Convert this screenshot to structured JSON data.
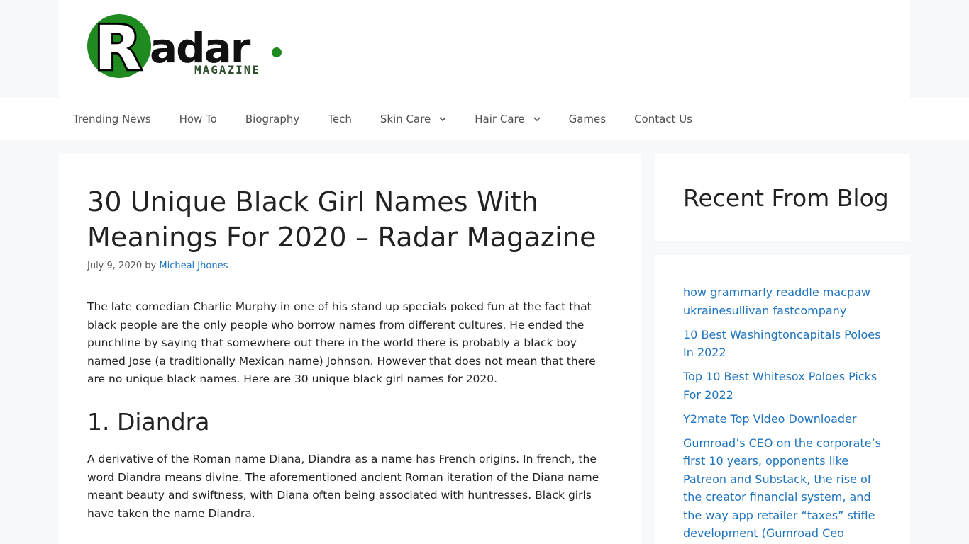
{
  "brand": {
    "logo_main": "Radar.",
    "logo_sub": "MAGAZINE",
    "green": "#1f8a1f",
    "dark_green": "#2f4f2f"
  },
  "nav": {
    "items": [
      {
        "label": "Trending News",
        "has_dropdown": false
      },
      {
        "label": "How To",
        "has_dropdown": false
      },
      {
        "label": "Biography",
        "has_dropdown": false
      },
      {
        "label": "Tech",
        "has_dropdown": false
      },
      {
        "label": "Skin Care",
        "has_dropdown": true
      },
      {
        "label": "Hair Care",
        "has_dropdown": true
      },
      {
        "label": "Games",
        "has_dropdown": false
      },
      {
        "label": "Contact Us",
        "has_dropdown": false
      }
    ]
  },
  "article": {
    "title": "30 Unique Black Girl Names With Meanings For 2020 – Radar Magazine",
    "date": "July 9, 2020",
    "by": "by",
    "author": "Micheal Jhones",
    "intro": "The late comedian Charlie Murphy in one of his stand up specials poked fun at the fact that black people are the only people who borrow names from different cultures. He ended the punchline by saying that somewhere out there in the world there is probably a black boy named Jose (a traditionally Mexican name) Johnson. However that does not mean that there are no unique black names. Here are 30 unique black girl names for 2020.",
    "section1_heading": "1. Diandra",
    "section1_text": "A derivative of the Roman name Diana, Diandra as a name has French origins. In french, the word Diandra means divine. The aforementioned ancient Roman iteration of the Diana name meant beauty and swiftness, with Diana often being associated with huntresses. Black girls have taken the name Diandra."
  },
  "sidebar": {
    "recent_title": "Recent From Blog",
    "posts": [
      "how grammarly readdle macpaw ukrainesullivan fastcompany",
      "10 Best Washingtoncapitals Poloes In 2022",
      "Top 10 Best Whitesox Poloes Picks For 2022",
      "Y2mate Top Video Downloader",
      "Gumroad’s CEO on the corporate’s first 10 years, opponents like Patreon and Substack, the rise of the creator financial system, and the way app retailer “taxes” stifle development (Gumroad Ceo Patreon"
    ]
  },
  "colors": {
    "link": "#1e73be",
    "page_bg": "#f7f8f9",
    "nav_text": "#515151"
  },
  "icons": {
    "dropdown": "chevron-down-icon"
  }
}
